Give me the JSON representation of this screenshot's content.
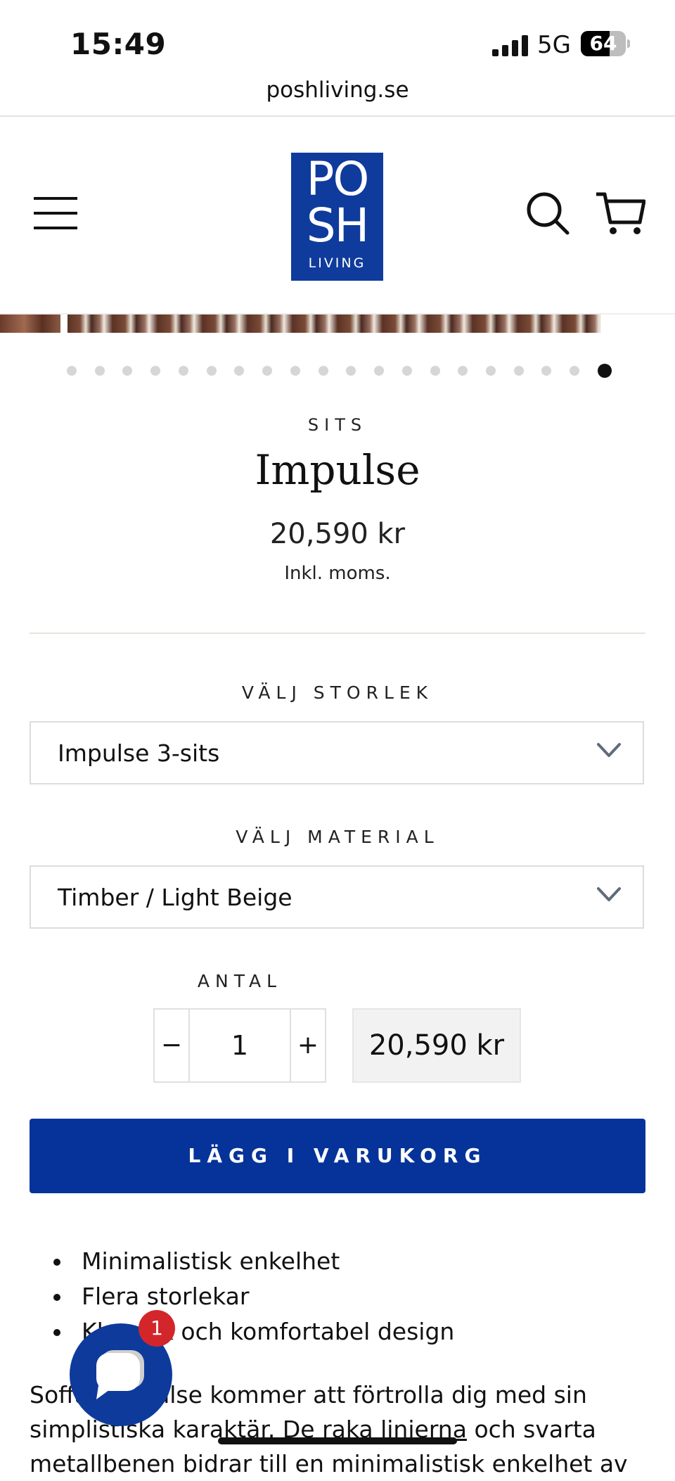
{
  "status_bar": {
    "time": "15:49",
    "network": "5G",
    "battery": "64",
    "battery_level": 0.64
  },
  "browser": {
    "url": "poshliving.se"
  },
  "header": {
    "logo": {
      "line1": "PO",
      "line2": "SH",
      "line3": "LIVING",
      "color": "#0f3b9c"
    },
    "icons": [
      "hamburger-menu-icon",
      "search-icon",
      "cart-icon"
    ]
  },
  "carousel": {
    "total_slides": 20,
    "active_index": 20
  },
  "product": {
    "category": "SITS",
    "title": "Impulse",
    "price": "20,590 kr",
    "tax_note": "Inkl. moms."
  },
  "options": {
    "size_label": "VÄLJ STORLEK",
    "size_value": "Impulse 3-sits",
    "material_label": "VÄLJ MATERIAL",
    "material_value": "Timber / Light Beige"
  },
  "quantity": {
    "label": "ANTAL",
    "minus": "−",
    "value": "1",
    "plus": "+",
    "total": "20,590 kr"
  },
  "cta": {
    "label": "LÄGG I VARUKORG",
    "color": "#053399"
  },
  "features": [
    "Minimalistisk enkelhet",
    "Flera storlekar",
    "Klassisk och komfortabel design"
  ],
  "description": {
    "line1": "Soffan Impulse kommer att förtrolla dig med sin",
    "line2a": "simplistiska karaktär. ",
    "line2b": "De raka linjerna",
    "line2c": " och svarta",
    "line3": "metallbenen bidrar till en minimalistisk enkelhet av"
  },
  "chat": {
    "badge": "1",
    "badge_color": "#d3262b"
  }
}
